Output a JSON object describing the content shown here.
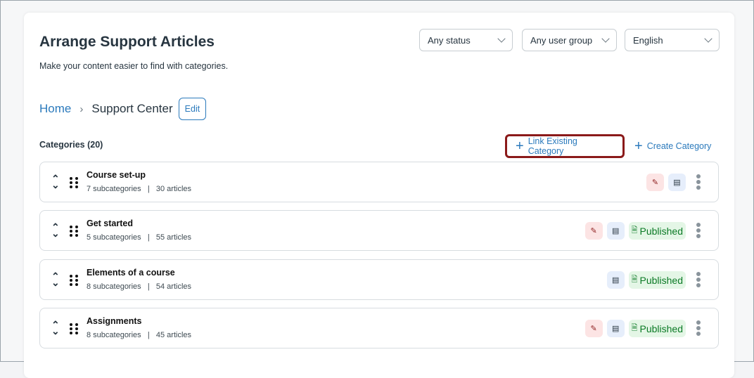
{
  "header": {
    "title": "Arrange Support Articles",
    "subtitle": "Make your content easier to find with categories."
  },
  "filters": [
    {
      "value": "Any status"
    },
    {
      "value": "Any user group"
    },
    {
      "value": "English"
    }
  ],
  "breadcrumb": {
    "home": "Home",
    "current": "Support Center",
    "edit_label": "Edit"
  },
  "categories_heading": "Categories (20)",
  "actions": {
    "link_existing": "Link Existing Category",
    "create": "Create Category"
  },
  "rows": [
    {
      "name": "Course set-up",
      "subcategories": "7 subcategories",
      "articles": "30 articles",
      "divider": "|",
      "published": null
    },
    {
      "name": "Get started",
      "subcategories": "5 subcategories",
      "articles": "55 articles",
      "divider": "|",
      "published": "Published"
    },
    {
      "name": "Elements of a course",
      "subcategories": "8 subcategories",
      "articles": "54 articles",
      "divider": "|",
      "published": "Published"
    },
    {
      "name": "Assignments",
      "subcategories": "8 subcategories",
      "articles": "45 articles",
      "divider": "|",
      "published": "Published"
    }
  ],
  "colors": {
    "accent": "#2b7abc",
    "highlight": "#8b1a1a",
    "published": "#0b7a25"
  }
}
